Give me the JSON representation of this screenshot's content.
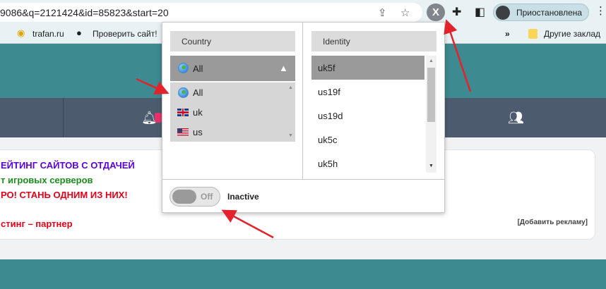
{
  "browser": {
    "url": "9086&q=2121424&id=85823&start=20",
    "extension_label": "X",
    "profile_label": "Приостановлена"
  },
  "bookmarks": [
    {
      "label": ""
    },
    {
      "label": "trafan.ru"
    },
    {
      "label": "Проверить сайт!"
    },
    {
      "label": "Другие заклад"
    }
  ],
  "page": {
    "lines": [
      {
        "text": "ЕЙТИНГ САЙТОВ С ОТДАЧЕЙ",
        "color": "#5b00d6"
      },
      {
        "text": "т игровых серверов",
        "color": "#1e8c1e"
      },
      {
        "text": "РО! СТАНЬ ОДНИМ ИЗ НИХ!",
        "color": "#e0001a"
      },
      {
        "text": "стинг – партнер",
        "color": "#e0001a"
      }
    ],
    "ad_link": "[Добавить рекламу]"
  },
  "popup": {
    "country_header": "Country",
    "identity_header": "Identity",
    "selected_country": "All",
    "country_options": [
      {
        "label": "All",
        "icon": "globe-icon"
      },
      {
        "label": "uk",
        "icon": "uk-flag-icon"
      },
      {
        "label": "us",
        "icon": "us-flag-icon"
      }
    ],
    "identities": [
      {
        "label": "uk5f",
        "selected": true
      },
      {
        "label": "us19f",
        "selected": false
      },
      {
        "label": "us19d",
        "selected": false
      },
      {
        "label": "uk5c",
        "selected": false
      },
      {
        "label": "uk5h",
        "selected": false
      }
    ],
    "toggle_label": "Off",
    "status": "Inactive"
  },
  "colors": {
    "teal": "#3d8a91",
    "nav": "#4d5b6e",
    "annotation": "#e3232c"
  }
}
